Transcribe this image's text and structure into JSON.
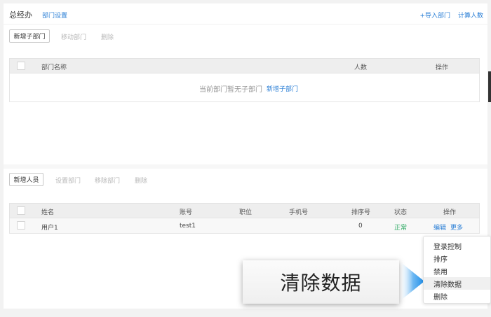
{
  "header": {
    "title": "总经办",
    "dept_settings": "部门设置",
    "import": "+导入部门",
    "count": "计算人数"
  },
  "subdept_toolbar": {
    "add": "新增子部门",
    "move": "移动部门",
    "delete": "删除"
  },
  "subdept_table": {
    "columns": [
      "部门名称",
      "人数",
      "操作"
    ],
    "empty_text": "当前部门暂无子部门",
    "empty_link": "新增子部门"
  },
  "member_toolbar": {
    "add": "新增人员",
    "set_dept": "设置部门",
    "remove_dept": "移除部门",
    "delete": "删除"
  },
  "member_table": {
    "columns": [
      "姓名",
      "账号",
      "职位",
      "手机号",
      "排序号",
      "状态",
      "操作"
    ],
    "rows": [
      {
        "name": "用户1",
        "account": "test1",
        "position": "",
        "phone": "",
        "order": "0",
        "status": "正常",
        "edit": "编辑",
        "more": "更多"
      }
    ]
  },
  "more_menu": {
    "items": [
      "登录控制",
      "排序",
      "禁用",
      "清除数据",
      "删除"
    ],
    "highlighted_index": 3
  },
  "callout": {
    "text": "清除数据"
  },
  "colors": {
    "link": "#2b7fd6",
    "status_ok": "#2aa860",
    "arrow": "#1e8de8"
  }
}
